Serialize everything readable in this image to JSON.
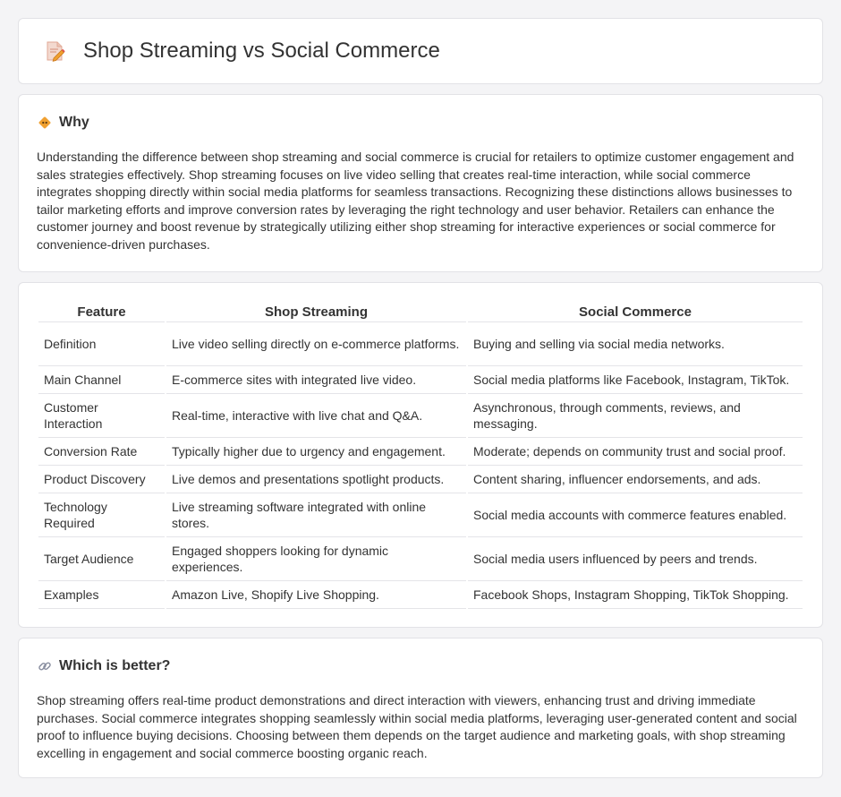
{
  "header": {
    "title": "Shop Streaming vs Social Commerce",
    "icon": "document-pencil-icon"
  },
  "why": {
    "icon": "diamond-warning-icon",
    "title": "Why",
    "text": "Understanding the difference between shop streaming and social commerce is crucial for retailers to optimize customer engagement and sales strategies effectively. Shop streaming focuses on live video selling that creates real-time interaction, while social commerce integrates shopping directly within social media platforms for seamless transactions. Recognizing these distinctions allows businesses to tailor marketing efforts and improve conversion rates by leveraging the right technology and user behavior. Retailers can enhance the customer journey and boost revenue by strategically utilizing either shop streaming for interactive experiences or social commerce for convenience-driven purchases."
  },
  "table": {
    "headers": [
      "Feature",
      "Shop Streaming",
      "Social Commerce"
    ],
    "rows": [
      [
        "Definition",
        "Live video selling directly on e-commerce platforms.",
        "Buying and selling via social media networks."
      ],
      [
        "Main Channel",
        "E-commerce sites with integrated live video.",
        "Social media platforms like Facebook, Instagram, TikTok."
      ],
      [
        "Customer Interaction",
        "Real-time, interactive with live chat and Q&A.",
        "Asynchronous, through comments, reviews, and messaging."
      ],
      [
        "Conversion Rate",
        "Typically higher due to urgency and engagement.",
        "Moderate; depends on community trust and social proof."
      ],
      [
        "Product Discovery",
        "Live demos and presentations spotlight products.",
        "Content sharing, influencer endorsements, and ads."
      ],
      [
        "Technology Required",
        "Live streaming software integrated with online stores.",
        "Social media accounts with commerce features enabled."
      ],
      [
        "Target Audience",
        "Engaged shoppers looking for dynamic experiences.",
        "Social media users influenced by peers and trends."
      ],
      [
        "Examples",
        "Amazon Live, Shopify Live Shopping.",
        "Facebook Shops, Instagram Shopping, TikTok Shopping."
      ]
    ]
  },
  "better": {
    "icon": "link-icon",
    "title": "Which is better?",
    "text": "Shop streaming offers real-time product demonstrations and direct interaction with viewers, enhancing trust and driving immediate purchases. Social commerce integrates shopping seamlessly within social media platforms, leveraging user-generated content and social proof to influence buying decisions. Choosing between them depends on the target audience and marketing goals, with shop streaming excelling in engagement and social commerce boosting organic reach."
  },
  "colors": {
    "background": "#f4f4f6",
    "card": "#ffffff",
    "border": "#e2e2e6",
    "text": "#333333",
    "accent_orange": "#f0a030"
  }
}
